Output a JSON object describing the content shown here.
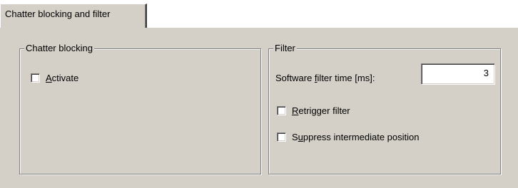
{
  "tabs": [
    {
      "label": "Chatter blocking and filter",
      "selected": true
    }
  ],
  "chatter_blocking": {
    "title": "Chatter blocking",
    "activate": {
      "pre": "",
      "acc": "A",
      "post": "ctivate",
      "checked": false
    }
  },
  "filter": {
    "title": "Filter",
    "software_filter_time": {
      "label_pre": "Software ",
      "label_acc": "f",
      "label_post": "ilter time [ms]:",
      "value": "3"
    },
    "retrigger": {
      "pre": "",
      "acc": "R",
      "post": "etrigger filter",
      "checked": false
    },
    "suppress": {
      "pre": "S",
      "acc": "u",
      "post": "ppress intermediate position",
      "checked": false
    }
  },
  "colors": {
    "face": "#d4d0c8",
    "shadow": "#808080",
    "highlight": "#ffffff"
  }
}
